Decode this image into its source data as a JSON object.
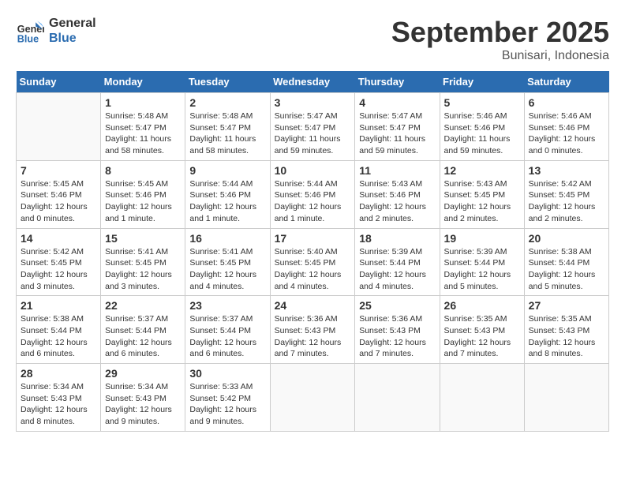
{
  "header": {
    "logo_line1": "General",
    "logo_line2": "Blue",
    "month": "September 2025",
    "location": "Bunisari, Indonesia"
  },
  "days_of_week": [
    "Sunday",
    "Monday",
    "Tuesday",
    "Wednesday",
    "Thursday",
    "Friday",
    "Saturday"
  ],
  "weeks": [
    [
      {
        "day": "",
        "info": ""
      },
      {
        "day": "1",
        "info": "Sunrise: 5:48 AM\nSunset: 5:47 PM\nDaylight: 11 hours\nand 58 minutes."
      },
      {
        "day": "2",
        "info": "Sunrise: 5:48 AM\nSunset: 5:47 PM\nDaylight: 11 hours\nand 58 minutes."
      },
      {
        "day": "3",
        "info": "Sunrise: 5:47 AM\nSunset: 5:47 PM\nDaylight: 11 hours\nand 59 minutes."
      },
      {
        "day": "4",
        "info": "Sunrise: 5:47 AM\nSunset: 5:47 PM\nDaylight: 11 hours\nand 59 minutes."
      },
      {
        "day": "5",
        "info": "Sunrise: 5:46 AM\nSunset: 5:46 PM\nDaylight: 11 hours\nand 59 minutes."
      },
      {
        "day": "6",
        "info": "Sunrise: 5:46 AM\nSunset: 5:46 PM\nDaylight: 12 hours\nand 0 minutes."
      }
    ],
    [
      {
        "day": "7",
        "info": "Sunrise: 5:45 AM\nSunset: 5:46 PM\nDaylight: 12 hours\nand 0 minutes."
      },
      {
        "day": "8",
        "info": "Sunrise: 5:45 AM\nSunset: 5:46 PM\nDaylight: 12 hours\nand 1 minute."
      },
      {
        "day": "9",
        "info": "Sunrise: 5:44 AM\nSunset: 5:46 PM\nDaylight: 12 hours\nand 1 minute."
      },
      {
        "day": "10",
        "info": "Sunrise: 5:44 AM\nSunset: 5:46 PM\nDaylight: 12 hours\nand 1 minute."
      },
      {
        "day": "11",
        "info": "Sunrise: 5:43 AM\nSunset: 5:46 PM\nDaylight: 12 hours\nand 2 minutes."
      },
      {
        "day": "12",
        "info": "Sunrise: 5:43 AM\nSunset: 5:45 PM\nDaylight: 12 hours\nand 2 minutes."
      },
      {
        "day": "13",
        "info": "Sunrise: 5:42 AM\nSunset: 5:45 PM\nDaylight: 12 hours\nand 2 minutes."
      }
    ],
    [
      {
        "day": "14",
        "info": "Sunrise: 5:42 AM\nSunset: 5:45 PM\nDaylight: 12 hours\nand 3 minutes."
      },
      {
        "day": "15",
        "info": "Sunrise: 5:41 AM\nSunset: 5:45 PM\nDaylight: 12 hours\nand 3 minutes."
      },
      {
        "day": "16",
        "info": "Sunrise: 5:41 AM\nSunset: 5:45 PM\nDaylight: 12 hours\nand 4 minutes."
      },
      {
        "day": "17",
        "info": "Sunrise: 5:40 AM\nSunset: 5:45 PM\nDaylight: 12 hours\nand 4 minutes."
      },
      {
        "day": "18",
        "info": "Sunrise: 5:39 AM\nSunset: 5:44 PM\nDaylight: 12 hours\nand 4 minutes."
      },
      {
        "day": "19",
        "info": "Sunrise: 5:39 AM\nSunset: 5:44 PM\nDaylight: 12 hours\nand 5 minutes."
      },
      {
        "day": "20",
        "info": "Sunrise: 5:38 AM\nSunset: 5:44 PM\nDaylight: 12 hours\nand 5 minutes."
      }
    ],
    [
      {
        "day": "21",
        "info": "Sunrise: 5:38 AM\nSunset: 5:44 PM\nDaylight: 12 hours\nand 6 minutes."
      },
      {
        "day": "22",
        "info": "Sunrise: 5:37 AM\nSunset: 5:44 PM\nDaylight: 12 hours\nand 6 minutes."
      },
      {
        "day": "23",
        "info": "Sunrise: 5:37 AM\nSunset: 5:44 PM\nDaylight: 12 hours\nand 6 minutes."
      },
      {
        "day": "24",
        "info": "Sunrise: 5:36 AM\nSunset: 5:43 PM\nDaylight: 12 hours\nand 7 minutes."
      },
      {
        "day": "25",
        "info": "Sunrise: 5:36 AM\nSunset: 5:43 PM\nDaylight: 12 hours\nand 7 minutes."
      },
      {
        "day": "26",
        "info": "Sunrise: 5:35 AM\nSunset: 5:43 PM\nDaylight: 12 hours\nand 7 minutes."
      },
      {
        "day": "27",
        "info": "Sunrise: 5:35 AM\nSunset: 5:43 PM\nDaylight: 12 hours\nand 8 minutes."
      }
    ],
    [
      {
        "day": "28",
        "info": "Sunrise: 5:34 AM\nSunset: 5:43 PM\nDaylight: 12 hours\nand 8 minutes."
      },
      {
        "day": "29",
        "info": "Sunrise: 5:34 AM\nSunset: 5:43 PM\nDaylight: 12 hours\nand 9 minutes."
      },
      {
        "day": "30",
        "info": "Sunrise: 5:33 AM\nSunset: 5:42 PM\nDaylight: 12 hours\nand 9 minutes."
      },
      {
        "day": "",
        "info": ""
      },
      {
        "day": "",
        "info": ""
      },
      {
        "day": "",
        "info": ""
      },
      {
        "day": "",
        "info": ""
      }
    ]
  ]
}
